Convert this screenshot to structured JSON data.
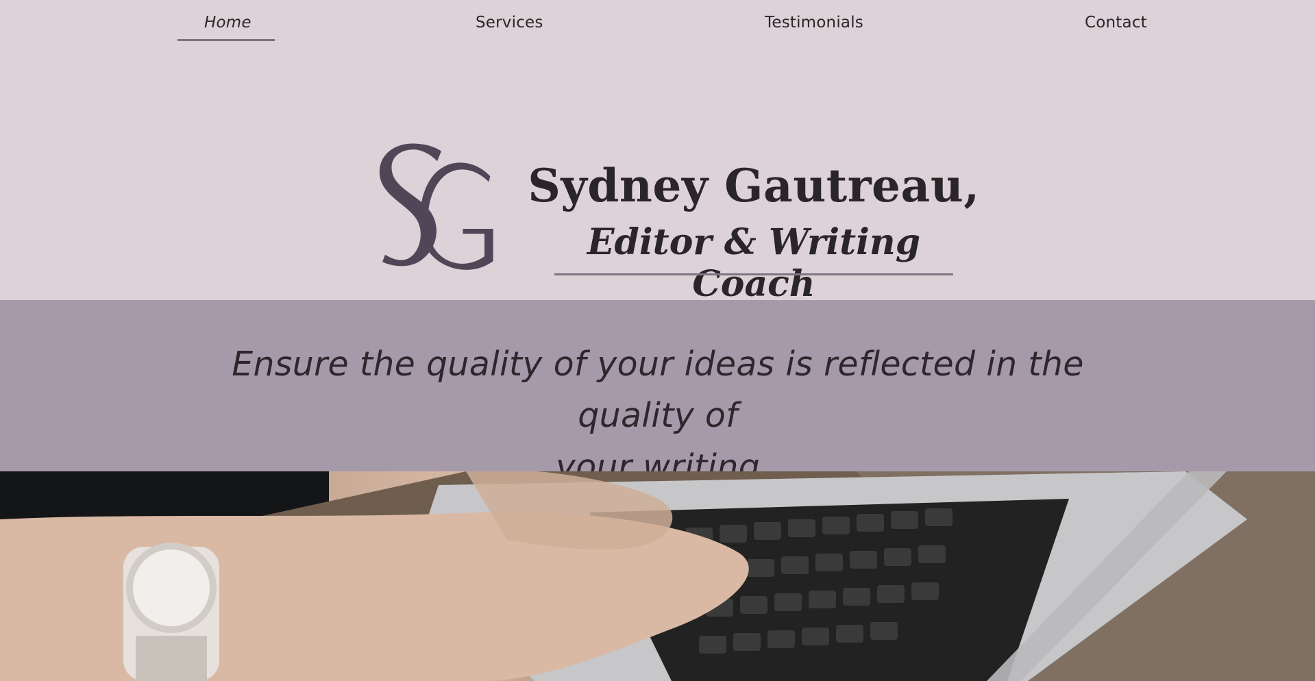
{
  "nav": {
    "items": [
      {
        "label": "Home",
        "active": true
      },
      {
        "label": "Services",
        "active": false
      },
      {
        "label": "Testimonials",
        "active": false
      },
      {
        "label": "Contact",
        "active": false
      }
    ]
  },
  "hero": {
    "logo_text": "SG",
    "name": "Sydney Gautreau,",
    "role": "Editor & Writing Coach"
  },
  "band": {
    "tagline_line1": "Ensure the quality of your ideas is reflected in the quality of",
    "tagline_line2": "your writing"
  },
  "photo": {
    "subject": "hands-typing-on-laptop-photo"
  },
  "colors": {
    "background": "#dcd2d8",
    "band": "#a69aaa",
    "logo": "#4f4658",
    "text": "#2a2528",
    "rule": "#7d7484"
  }
}
